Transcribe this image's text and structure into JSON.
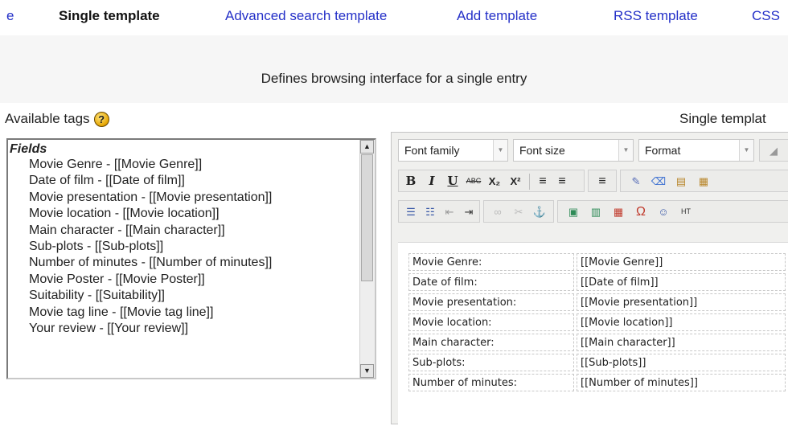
{
  "tabs": [
    {
      "label": "e",
      "active": false
    },
    {
      "label": "Single template",
      "active": true
    },
    {
      "label": "Advanced search template",
      "active": false
    },
    {
      "label": "Add template",
      "active": false
    },
    {
      "label": "RSS template",
      "active": false
    },
    {
      "label": "CSS",
      "active": false
    }
  ],
  "description": "Defines browsing interface for a single entry",
  "available_tags": {
    "label": "Available tags",
    "help_icon": "help-icon",
    "group": "Fields",
    "items": [
      "Movie Genre - [[Movie Genre]]",
      "Date of film - [[Date of film]]",
      "Movie presentation - [[Movie presentation]]",
      "Movie location - [[Movie location]]",
      "Main character - [[Main character]]",
      "Sub-plots - [[Sub-plots]]",
      "Number of minutes - [[Number of minutes]]",
      "Movie Poster - [[Movie Poster]]",
      "Suitability - [[Suitability]]",
      "Movie tag line - [[Movie tag line]]",
      "Your review - [[Your review]]"
    ]
  },
  "editor": {
    "label": "Single templat",
    "toolbar": {
      "font_family": "Font family",
      "font_size": "Font size",
      "format": "Format",
      "bold": "B",
      "italic": "I",
      "underline": "U",
      "strikethrough": "ABC",
      "subscript": "X₂",
      "superscript": "X²",
      "html": "HT"
    },
    "rows": [
      {
        "field": "Movie Genre:",
        "tag": "[[Movie Genre]]"
      },
      {
        "field": "Date of film:",
        "tag": "[[Date of film]]"
      },
      {
        "field": "Movie presentation:",
        "tag": "[[Movie presentation]]"
      },
      {
        "field": "Movie location:",
        "tag": "[[Movie location]]"
      },
      {
        "field": "Main character:",
        "tag": "[[Main character]]"
      },
      {
        "field": "Sub-plots:",
        "tag": "[[Sub-plots]]"
      },
      {
        "field": "Number of minutes:",
        "tag": "[[Number of minutes]]"
      }
    ]
  },
  "colors": {
    "link": "#2430c8",
    "band": "#f6f6f6",
    "toolbar_bg": "#f0f0ee"
  }
}
